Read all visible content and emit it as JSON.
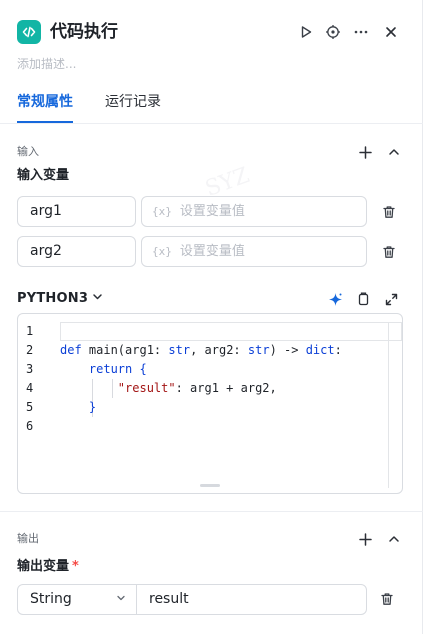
{
  "header": {
    "title": "代码执行",
    "description_placeholder": "添加描述..."
  },
  "tabs": [
    {
      "label": "常规属性",
      "active": true
    },
    {
      "label": "运行记录",
      "active": false
    }
  ],
  "input_section": {
    "section_label": "输入",
    "title": "输入变量",
    "variables": [
      {
        "name": "arg1",
        "value_placeholder": "设置变量值"
      },
      {
        "name": "arg2",
        "value_placeholder": "设置变量值"
      }
    ],
    "fx_symbol": "{x}"
  },
  "code": {
    "language": "PYTHON3",
    "line_numbers": [
      "1",
      "2",
      "3",
      "4",
      "5",
      "6"
    ],
    "lines": [
      "",
      "def main(arg1: str, arg2: str) -> dict:",
      "    return {",
      "        \"result\": arg1 + arg2,",
      "    }",
      ""
    ]
  },
  "output_section": {
    "section_label": "输出",
    "title": "输出变量",
    "required_mark": "*",
    "type": "String",
    "name": "result"
  },
  "watermark": "SYZ",
  "colors": {
    "accent": "#1668dc",
    "app_icon": "#12b5a5",
    "keyword": "#0b3fd6",
    "string": "#a31515",
    "required": "#f54a45",
    "ai_sparkle": "#1668dc"
  }
}
